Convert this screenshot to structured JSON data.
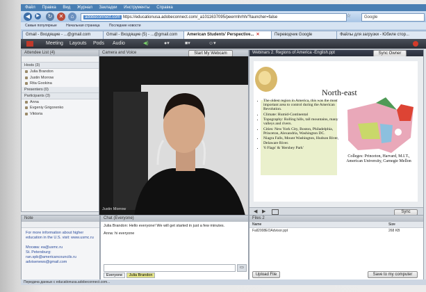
{
  "browser": {
    "menu": [
      "Файл",
      "Правка",
      "Вид",
      "Журнал",
      "Закладки",
      "Инструменты",
      "Справка"
    ],
    "url_host": "adobeconnect.com",
    "url": "https://educationusa.adobeconnect.com/_a1011637095/peerrnhrhh/?launcher=false",
    "search_placeholder": "Google",
    "bookmarks": [
      "Самые популярные",
      "Начальная страница",
      "Последние новости"
    ],
    "tabs": [
      {
        "label": "Gmail - Входящие - ...@gmail.com"
      },
      {
        "label": "Gmail - Входящие (5) - ...@gmail.com"
      },
      {
        "label": "American Students' Perspective...",
        "active": true
      },
      {
        "label": "Переводчик Google"
      },
      {
        "label": "Файлы для загрузки - Юбиле стор..."
      }
    ]
  },
  "connect": {
    "menu": [
      "Meeting",
      "Layouts",
      "Pods",
      "Audio"
    ],
    "attendees_title": "Attendee List (4)",
    "groups": [
      {
        "label": "Hosts (3)",
        "members": [
          "Julia Brandon",
          "Justin Morrow",
          "Rita Gookina"
        ]
      },
      {
        "label": "Presenters (0)",
        "members": []
      },
      {
        "label": "Participants (3)",
        "members": [
          "Anna",
          "Evgeniy Grigorenko",
          "Viktoria"
        ]
      }
    ],
    "camera_title": "Camera and Voice",
    "webcam_button": "Start My Webcam",
    "cam_name": "Justin Morrow",
    "share_title": "Webinars 2. Regions of America -English.ppt",
    "sync_button": "Sync Owner",
    "slide": {
      "title": "North-east",
      "bullets": [
        "The oldest region in America, this was the most important area to control during the American Revolution.",
        "Climate: Humid-Continental",
        "Topography: Rolling hills, tall mountains, many valleys and rivers.",
        "Cities: New York City, Boston, Philadelphia, Princeton, Alexandria, Washington DC.",
        "Niagra Falls, Mount Washington, Hudson River, Delaware River.",
        "'6 Flags' & 'Hershey Park'"
      ],
      "colleges": "Colleges: Princeton, Harvard, M.I.T., American University, Carnegie Mellon"
    },
    "sync_footer": "Sync",
    "note_title": "Note",
    "note_text": "For more information about higher education in the U.S. visit: www.usmc.ru\n\nМосква: ea@usmc.ru\nSt. Petersburg: ran.spb@americancouncils.ru\nadvisenews@gmail.com",
    "chat_title": "Chat (Everyone)",
    "chat_messages": [
      "Julia Brandon: Hello everyone! We will get started in just a few minutes.",
      "Anna: hi everyone"
    ],
    "chat_tabs": [
      "Everyone",
      "Julia Brandon"
    ],
    "files_title": "Files 2",
    "files_headers": [
      "Name",
      "Size"
    ],
    "files": [
      {
        "name": "Fall2008EOAdvisor.ppt",
        "size": "268 KB"
      }
    ],
    "upload_button": "Upload File",
    "save_button": "Save to my computer"
  },
  "status_text": "Передача данных с educationusa.adobeconnect.com..."
}
